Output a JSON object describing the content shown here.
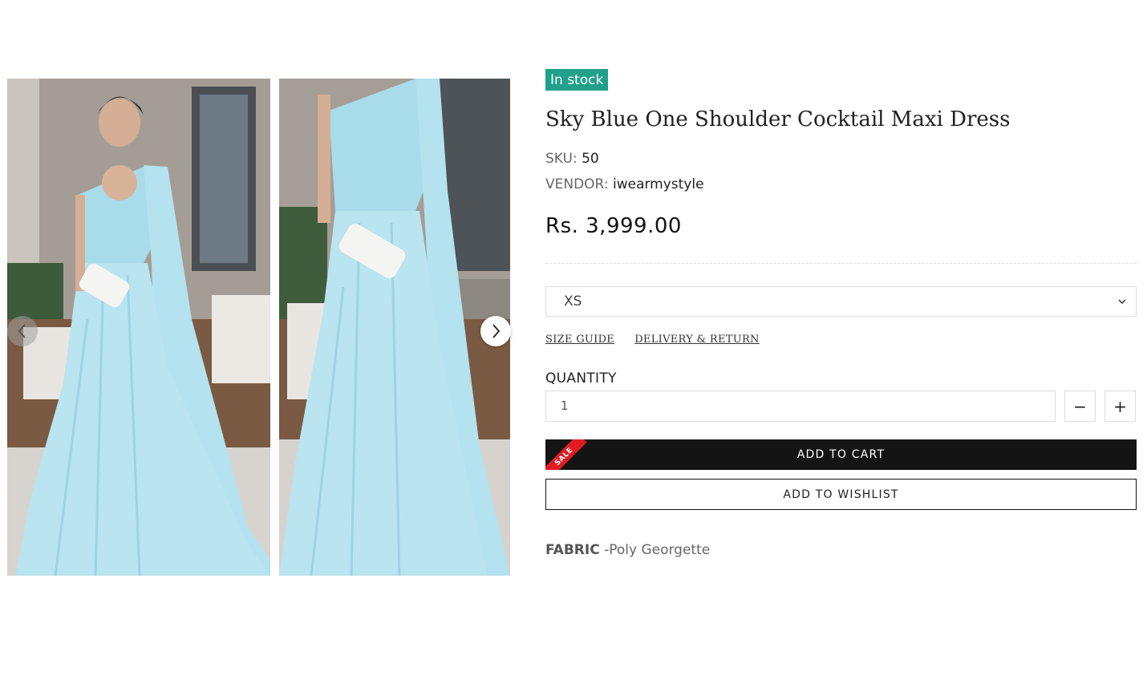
{
  "gallery": {
    "prev_icon": "chevron-left-icon",
    "next_icon": "chevron-right-icon",
    "dress_color": "#a9dcea"
  },
  "product": {
    "stock_status": "In stock",
    "title": "Sky Blue One Shoulder Cocktail Maxi Dress",
    "sku_label": "SKU:",
    "sku_value": "50",
    "vendor_label": "VENDOR:",
    "vendor_value": "iwearmystyle",
    "price": "Rs. 3,999.00",
    "size_selected": "XS",
    "size_guide_link": "SIZE GUIDE",
    "delivery_link": "DELIVERY & RETURN",
    "quantity_label": "QUANTITY",
    "quantity_value": "1",
    "minus": "−",
    "plus": "+",
    "sale_ribbon": "SALE",
    "add_to_cart": "ADD TO CART",
    "add_to_wishlist": "ADD TO WISHLIST",
    "fabric_label": "FABRIC",
    "fabric_value": "-Poly Georgette"
  },
  "colors": {
    "stock_badge": "#21a08a",
    "cart_button": "#141414",
    "sale_ribbon": "#e01b22"
  }
}
